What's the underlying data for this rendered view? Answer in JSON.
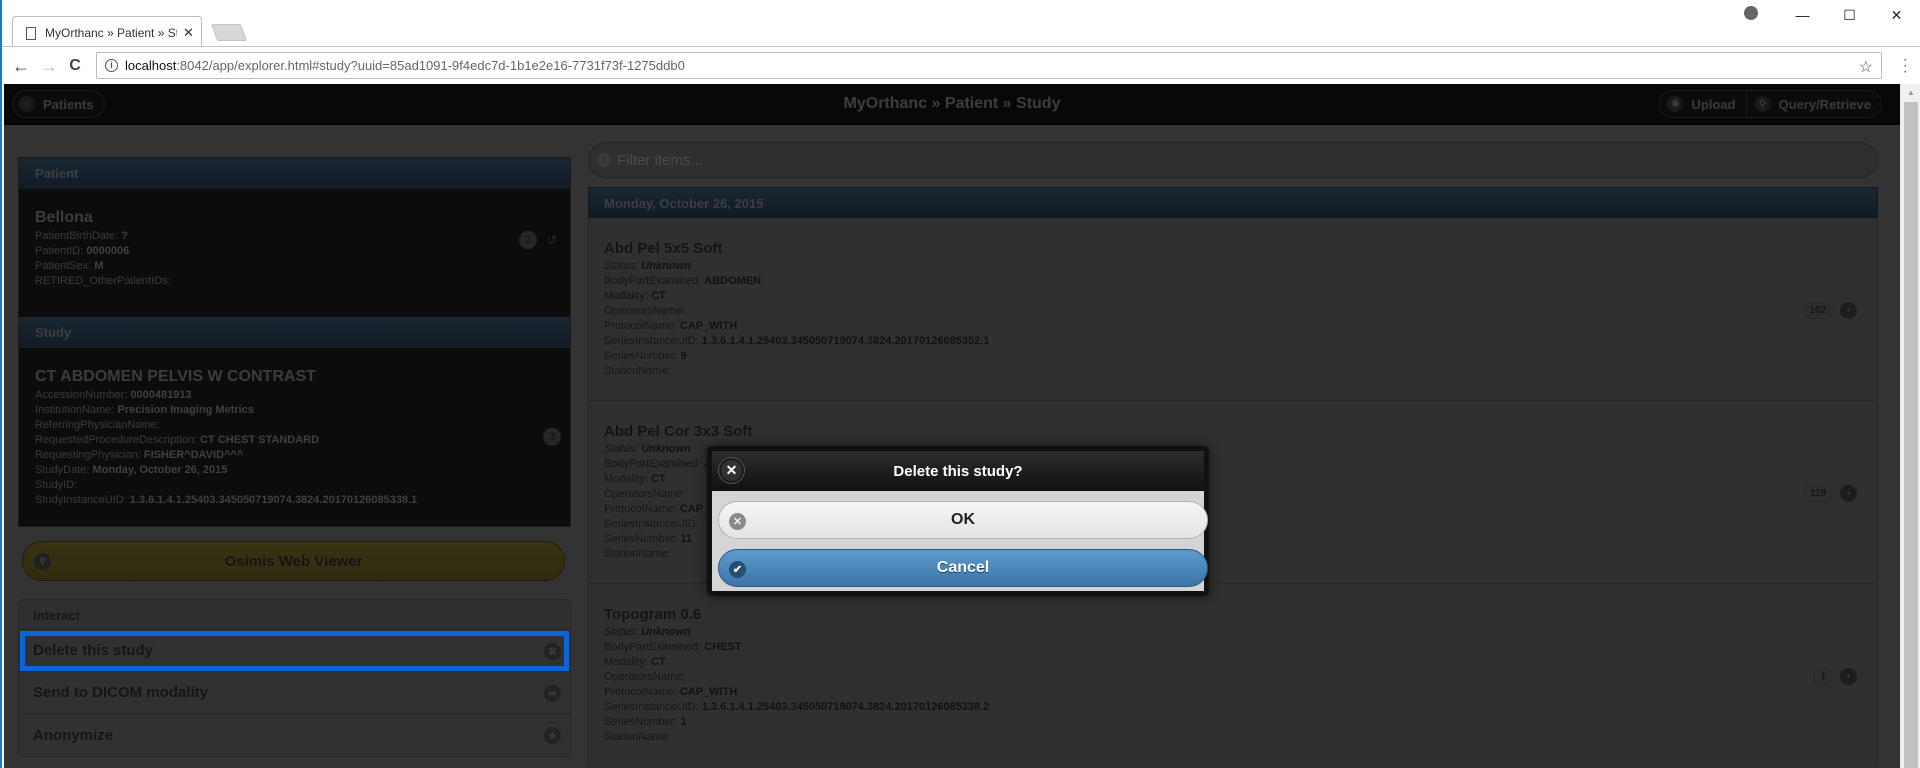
{
  "browser": {
    "tab_title": "MyOrthanc » Patient » St",
    "tab_close": "✕",
    "url_host": "localhost",
    "url_rest": ":8042/app/explorer.html#study?uuid=85ad1091-9f4edc7d-1b1e2e16-7731f73f-1275ddb0",
    "back": "←",
    "forward": "→",
    "reload": "C",
    "star": "☆",
    "menu": "⋮",
    "minimize": "—",
    "maximize": "☐",
    "close": "✕"
  },
  "header": {
    "patients_label": "Patients",
    "title": "MyOrthanc » Patient » Study",
    "upload_label": "Upload",
    "query_label": "Query/Retrieve"
  },
  "patient": {
    "section_label": "Patient",
    "name": "Bellona",
    "fields": [
      {
        "key": "PatientBirthDate: ",
        "value": "?"
      },
      {
        "key": "PatientID: ",
        "value": "0000006"
      },
      {
        "key": "PatientSex: ",
        "value": "M"
      },
      {
        "key": "RETIRED_OtherPatientIDs:",
        "value": ""
      }
    ],
    "study_count": "2"
  },
  "study": {
    "section_label": "Study",
    "name": "CT ABDOMEN PELVIS W CONTRAST",
    "fields": [
      {
        "key": "AccessionNumber: ",
        "value": "0000481913"
      },
      {
        "key": "InstitutionName: ",
        "value": "Precision Imaging Metrics"
      },
      {
        "key": "ReferringPhysicianName:",
        "value": ""
      },
      {
        "key": "RequestedProcedureDescription: ",
        "value": "CT CHEST STANDARD"
      },
      {
        "key": "RequestingPhysician: ",
        "value": "FISHER^DAVID^^^"
      },
      {
        "key": "StudyDate: ",
        "value": "Monday, October 26, 2015"
      },
      {
        "key": "StudyID:",
        "value": ""
      },
      {
        "key": "StudyInstanceUID: ",
        "value": "1.3.6.1.4.1.25403.345050719074.3824.20170126085338.1"
      }
    ],
    "series_count": "3"
  },
  "osimis_label": "Osimis Web Viewer",
  "interact": {
    "title": "Interact",
    "items": [
      {
        "label": "Delete this study",
        "icon": "✖"
      },
      {
        "label": "Send to DICOM modality",
        "icon": "➦"
      },
      {
        "label": "Anonymize",
        "icon": "★"
      }
    ]
  },
  "filter": {
    "placeholder": "Filter items..."
  },
  "series_group_date": "Monday, October 26, 2015",
  "series": [
    {
      "title": "Abd Pel 5x5 Soft",
      "status_key": "Status: ",
      "status": "Unknown",
      "fields": [
        {
          "key": "BodyPartExamined: ",
          "value": "ABDOMEN"
        },
        {
          "key": "Modality: ",
          "value": "CT"
        },
        {
          "key": "OperatorsName:",
          "value": ""
        },
        {
          "key": "ProtocolName: ",
          "value": "CAP_WITH"
        },
        {
          "key": "SeriesInstanceUID: ",
          "value": "1.3.6.1.4.1.25403.345050719074.3824.20170126085352.1"
        },
        {
          "key": "SeriesNumber: ",
          "value": "9"
        },
        {
          "key": "StationName:",
          "value": ""
        }
      ],
      "count": "102"
    },
    {
      "title": "Abd Pel Cor 3x3 Soft",
      "status_key": "Status: ",
      "status": "Unknown",
      "fields": [
        {
          "key": "BodyPartExamined: ",
          "value": "ABDOMEN"
        },
        {
          "key": "Modality: ",
          "value": "CT"
        },
        {
          "key": "OperatorsName:",
          "value": ""
        },
        {
          "key": "ProtocolName: ",
          "value": "CAP_WITH"
        },
        {
          "key": "SeriesInstanceUID: ",
          "value": ""
        },
        {
          "key": "SeriesNumber: ",
          "value": "11"
        },
        {
          "key": "StationName:",
          "value": ""
        }
      ],
      "count": "119"
    },
    {
      "title": "Topogram 0.6",
      "status_key": "Status: ",
      "status": "Unknown",
      "fields": [
        {
          "key": "BodyPartExamined: ",
          "value": "CHEST"
        },
        {
          "key": "Modality: ",
          "value": "CT"
        },
        {
          "key": "OperatorsName:",
          "value": ""
        },
        {
          "key": "ProtocolName: ",
          "value": "CAP_WITH"
        },
        {
          "key": "SeriesInstanceUID: ",
          "value": "1.3.6.1.4.1.25403.345050719074.3824.20170126085338.2"
        },
        {
          "key": "SeriesNumber: ",
          "value": "1"
        },
        {
          "key": "StationName:",
          "value": ""
        }
      ],
      "count": "1"
    }
  ],
  "dialog": {
    "title": "Delete this study?",
    "ok_label": "OK",
    "cancel_label": "Cancel"
  },
  "colors": {
    "focus_outline": "#0a66d6",
    "cancel_button": "#4a86bb",
    "section_header": "#1a2633"
  }
}
